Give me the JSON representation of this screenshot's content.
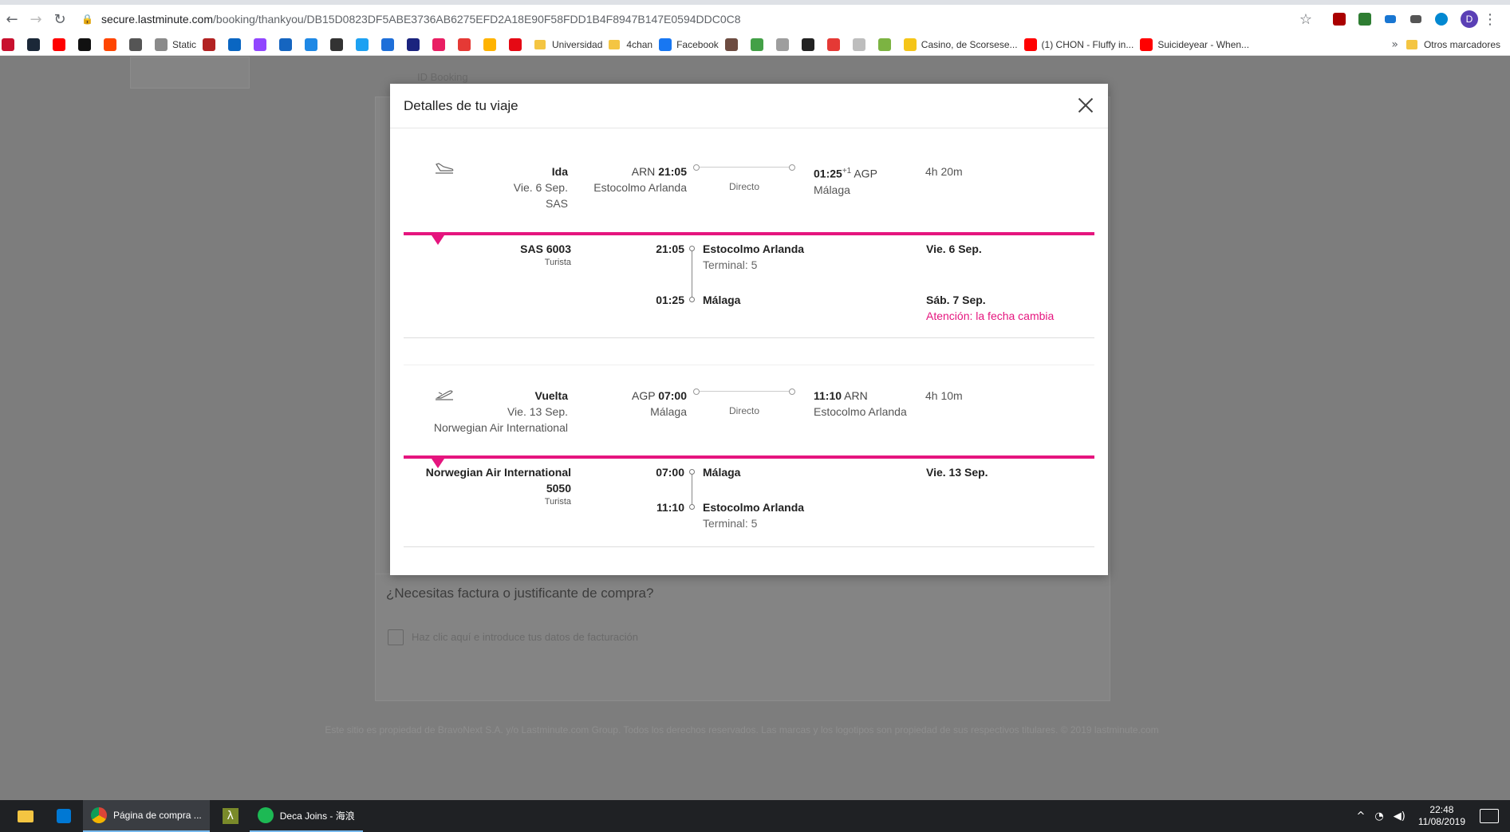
{
  "browser": {
    "url_host": "secure.lastminute.com",
    "url_path": "/booking/thankyou/DB15D0823DF5ABE3736AB6275EFD2A18E90F58FDD1B4F8947B147E0594DDC0C8",
    "profile_initial": "D",
    "extension_badge": "4"
  },
  "bookmarks": [
    {
      "label": "",
      "color": "#c8102e"
    },
    {
      "label": "",
      "color": "#1b2838"
    },
    {
      "label": "",
      "color": "#ff0000"
    },
    {
      "label": "",
      "color": "#111111"
    },
    {
      "label": "",
      "color": "#ff4500"
    },
    {
      "label": "",
      "color": "#555555"
    },
    {
      "label": "Static",
      "color": "#8a8a8a"
    },
    {
      "label": "",
      "color": "#b22222"
    },
    {
      "label": "",
      "color": "#0a66c2"
    },
    {
      "label": "",
      "color": "#9146ff"
    },
    {
      "label": "",
      "color": "#1565c0"
    },
    {
      "label": "",
      "color": "#1e88e5"
    },
    {
      "label": "",
      "color": "#333333"
    },
    {
      "label": "",
      "color": "#1da1f2"
    },
    {
      "label": "",
      "color": "#1e6fd9"
    },
    {
      "label": "",
      "color": "#1a237e"
    },
    {
      "label": "",
      "color": "#e91e63"
    },
    {
      "label": "",
      "color": "#e53935"
    },
    {
      "label": "",
      "color": "#ffb300"
    },
    {
      "label": "",
      "color": "#e50914"
    },
    {
      "label": "Universidad",
      "color": "#f4c542",
      "folder": true
    },
    {
      "label": "4chan",
      "color": "#f4c542",
      "folder": true
    },
    {
      "label": "Facebook",
      "color": "#1877f2"
    },
    {
      "label": "",
      "color": "#6d4c41"
    },
    {
      "label": "",
      "color": "#43a047"
    },
    {
      "label": "",
      "color": "#9e9e9e"
    },
    {
      "label": "",
      "color": "#222222"
    },
    {
      "label": "",
      "color": "#e53935"
    },
    {
      "label": "",
      "color": "#bdbdbd"
    },
    {
      "label": "",
      "color": "#7cb342"
    },
    {
      "label": "Casino, de Scorsese...",
      "color": "#f5c518"
    },
    {
      "label": "(1) CHON - Fluffy in...",
      "color": "#ff0000"
    },
    {
      "label": "Suicideyear - When...",
      "color": "#ff0000"
    }
  ],
  "bookmarks_more": "»",
  "bookmarks_other": "Otros marcadores",
  "background_page": {
    "id_booking_label": "ID Booking",
    "invoice_title": "¿Necesitas factura o justificante de compra?",
    "invoice_link": "Haz clic aquí e introduce tus datos de facturación",
    "footer": "Este sitio es propiedad de BravoNext S.A. y/o Lastminute.com Group. Todos los derechos reservados. Las marcas y los logotipos son propiedad de sus respectivos titulares. © 2019 lastminute.com"
  },
  "modal": {
    "title": "Detalles de tu viaje",
    "outbound": {
      "direction": "Ida",
      "date": "Vie. 6 Sep.",
      "airline": "SAS",
      "dep_code": "ARN",
      "dep_time": "21:05",
      "dep_city": "Estocolmo Arlanda",
      "stops": "Directo",
      "arr_time": "01:25",
      "arr_plus": "+1",
      "arr_code": "AGP",
      "arr_city": "Málaga",
      "duration": "4h 20m",
      "flight": "SAS 6003",
      "cabin": "Turista",
      "seg_dep_time": "21:05",
      "seg_dep_place": "Estocolmo Arlanda",
      "seg_dep_terminal": "Terminal: 5",
      "seg_dep_date": "Vie. 6 Sep.",
      "seg_arr_time": "01:25",
      "seg_arr_place": "Málaga",
      "seg_arr_date": "Sáb. 7 Sep.",
      "date_warning": "Atención: la fecha cambia"
    },
    "return": {
      "direction": "Vuelta",
      "date": "Vie. 13 Sep.",
      "airline": "Norwegian Air International",
      "dep_code": "AGP",
      "dep_time": "07:00",
      "dep_city": "Málaga",
      "stops": "Directo",
      "arr_time": "11:10",
      "arr_code": "ARN",
      "arr_city": "Estocolmo Arlanda",
      "duration": "4h 10m",
      "flight_line1": "Norwegian Air International",
      "flight_line2": "5050",
      "cabin": "Turista",
      "seg_dep_time": "07:00",
      "seg_dep_place": "Málaga",
      "seg_dep_date": "Vie. 13 Sep.",
      "seg_arr_time": "11:10",
      "seg_arr_place": "Estocolmo Arlanda",
      "seg_arr_terminal": "Terminal: 5"
    }
  },
  "taskbar": {
    "chrome_label": "Página de compra ...",
    "spotify_label": "Deca Joins - 海浪",
    "time": "22:48",
    "date": "11/08/2019"
  },
  "colors": {
    "accent": "#e5157e"
  }
}
